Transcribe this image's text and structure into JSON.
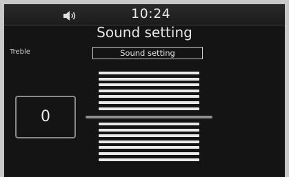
{
  "status_bar": {
    "time": "10:24",
    "volume_icon": "speaker-icon"
  },
  "page": {
    "title": "Sound setting",
    "side_label": "Treble",
    "selector_label": "Sound setting",
    "value": "0"
  },
  "level_indicator": {
    "bars_above_center": 7,
    "bars_below_center": 7,
    "current_level": 0
  },
  "colors": {
    "background": "#141414",
    "text": "#e6e6e6",
    "bar": "#e9e9e9",
    "center_line": "#8f8f8f"
  }
}
